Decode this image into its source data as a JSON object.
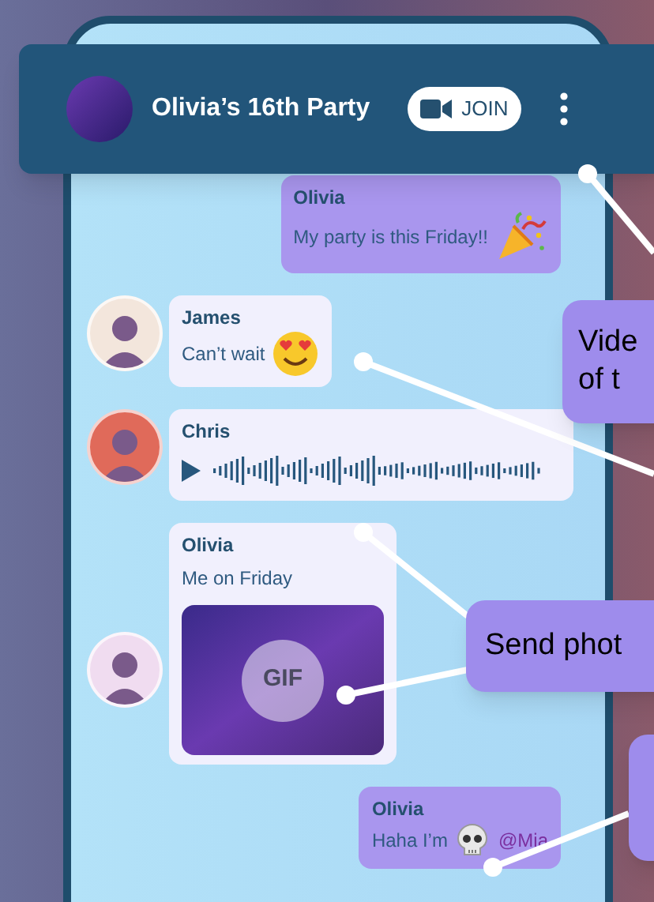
{
  "chat": {
    "title": "Olivia’s 16th Party",
    "join_button": "JOIN",
    "messages": [
      {
        "kind": "text",
        "sender": "Olivia",
        "outgoing": true,
        "text": "My party is this Friday!!",
        "sticker": {
          "kind": "party-popper"
        }
      },
      {
        "kind": "text",
        "sender": "James",
        "outgoing": false,
        "text": "Can’t wait",
        "sticker": {
          "kind": "heart-eyes"
        }
      },
      {
        "kind": "voice",
        "sender": "Chris",
        "outgoing": false
      },
      {
        "kind": "gif",
        "sender": "Olivia",
        "outgoing": false,
        "text": "Me on Friday",
        "badge": "GIF"
      },
      {
        "kind": "text",
        "sender": "Olivia",
        "outgoing": true,
        "text": "Haha I’m",
        "sticker": {
          "kind": "skull"
        },
        "mention": "@Mia"
      }
    ]
  },
  "callouts": [
    {
      "lines": [
        "Vide",
        "of t"
      ]
    },
    {
      "lines": [
        "Send phot"
      ]
    }
  ]
}
